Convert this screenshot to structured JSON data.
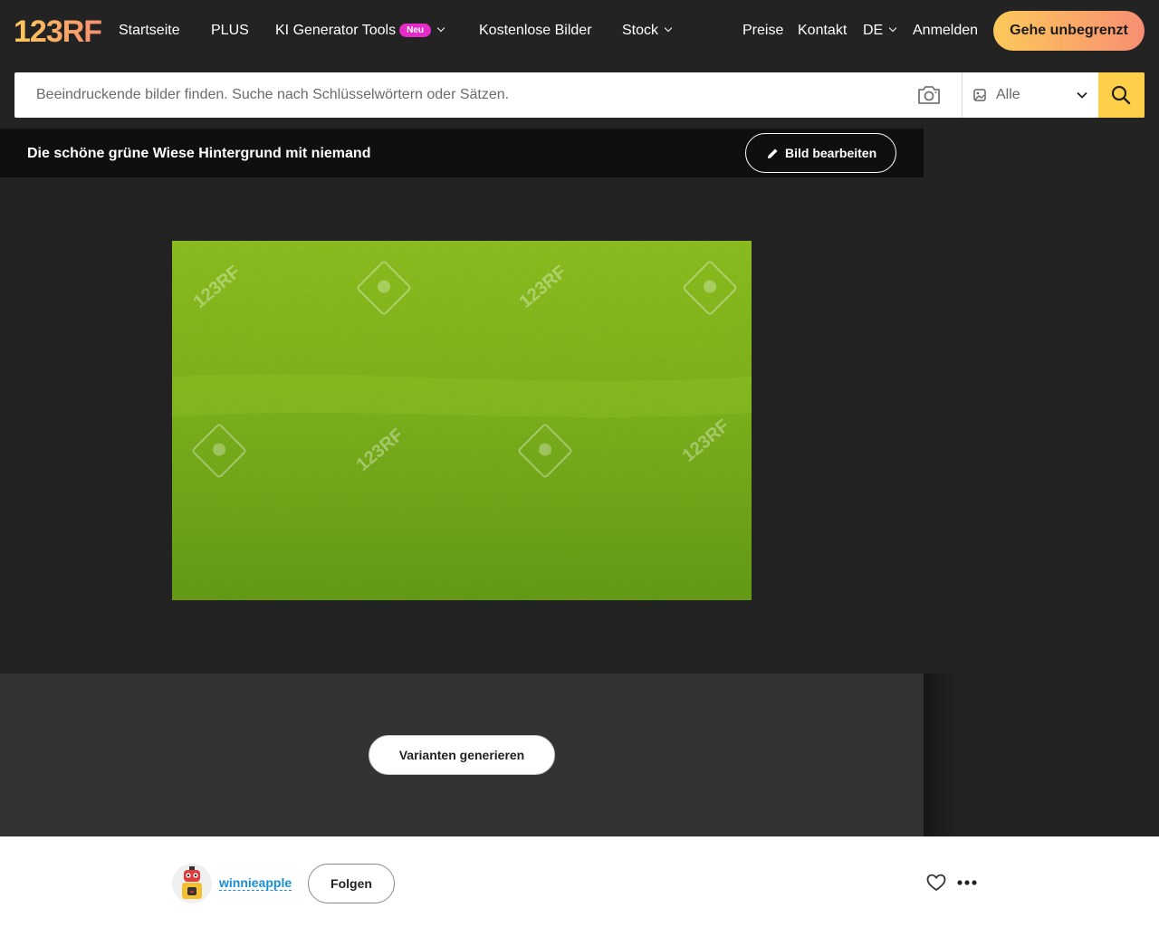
{
  "brand": {
    "logo_text": "123RF",
    "accent": "#fecf48"
  },
  "nav": {
    "home": "Startseite",
    "plus": "PLUS",
    "ai_tools": "KI Generator Tools",
    "ai_badge": "Neu",
    "free_images": "Kostenlose Bilder",
    "stock": "Stock",
    "pricing": "Preise",
    "contact": "Kontakt",
    "language": "DE",
    "login": "Anmelden",
    "cta": "Gehe unbegrenzt"
  },
  "search": {
    "placeholder": "Beeindruckende bilder finden. Suche nach Schlüsselwörtern oder Sätzen.",
    "value": "",
    "type_selected": "Alle",
    "camera_icon": "camera-icon",
    "search_icon": "search-icon"
  },
  "image": {
    "title": "Die schöne grüne Wiese Hintergrund mit niemand",
    "edit_label": "Bild bearbeiten",
    "watermark": "123RF"
  },
  "variants": {
    "button_label": "Varianten generieren"
  },
  "author": {
    "name": "winnieapple",
    "follow_label": "Folgen",
    "like_icon": "heart-icon",
    "more_icon": "more-icon"
  }
}
